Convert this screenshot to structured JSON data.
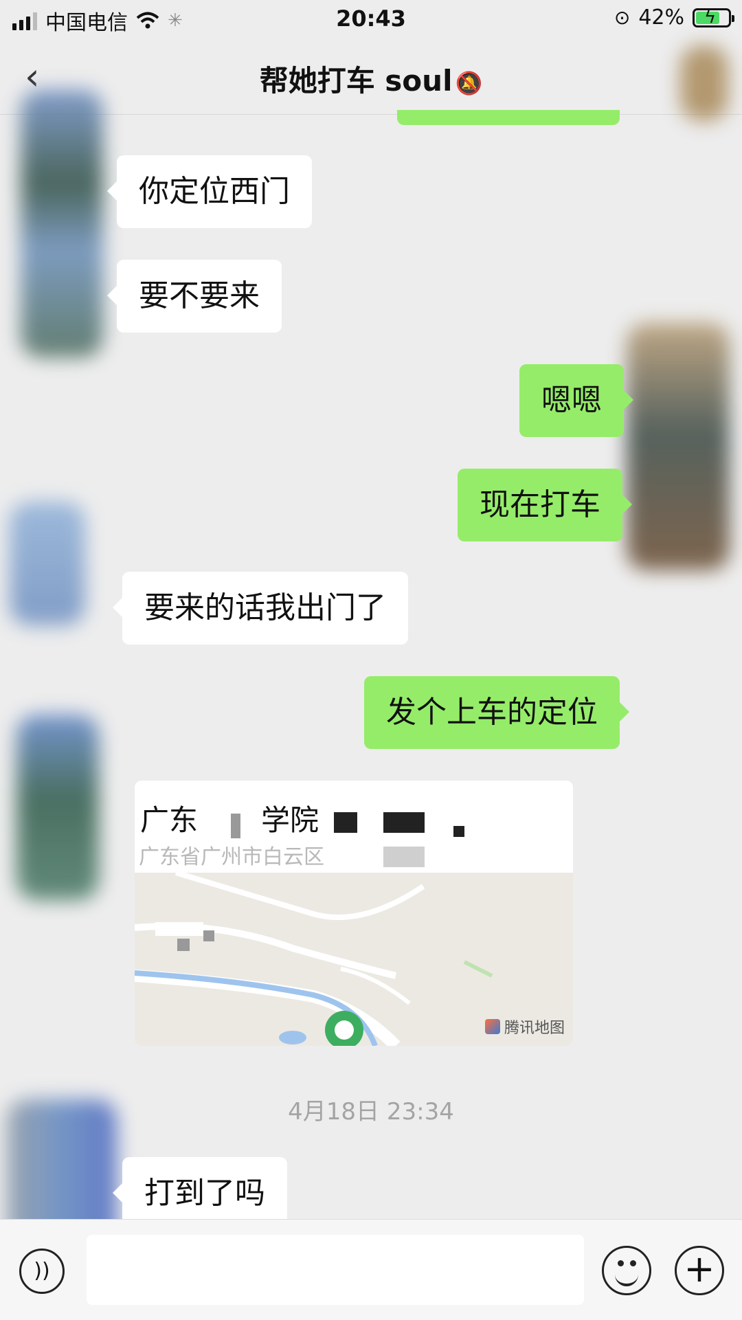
{
  "status_bar": {
    "carrier": "中国电信",
    "time": "20:43",
    "battery": "42%"
  },
  "nav": {
    "title": "帮她打车 soul",
    "back_icon": "chevron-left-icon",
    "mute_icon": "bell-off-icon"
  },
  "messages": [
    {
      "side": "left",
      "text": "你定位西门"
    },
    {
      "side": "left",
      "text": "要不要来"
    },
    {
      "side": "right",
      "text": "嗯嗯"
    },
    {
      "side": "right",
      "text": "现在打车"
    },
    {
      "side": "left",
      "text": "要来的话我出门了"
    },
    {
      "side": "right",
      "text": "发个上车的定位"
    },
    {
      "side": "left",
      "text": "打到了吗"
    }
  ],
  "location": {
    "title_part1": "广东",
    "title_part2": "学院",
    "address": "广东省广州市白云区",
    "map_brand": "腾讯地图"
  },
  "timestamp": "4月18日 23:34",
  "input_bar": {
    "placeholder": "",
    "voice_icon": "voice-icon",
    "emoji_icon": "emoji-icon",
    "plus_icon": "plus-icon"
  },
  "colors": {
    "chat_bg": "#ededed",
    "sent_bubble": "#95ec69",
    "received_bubble": "#ffffff"
  }
}
